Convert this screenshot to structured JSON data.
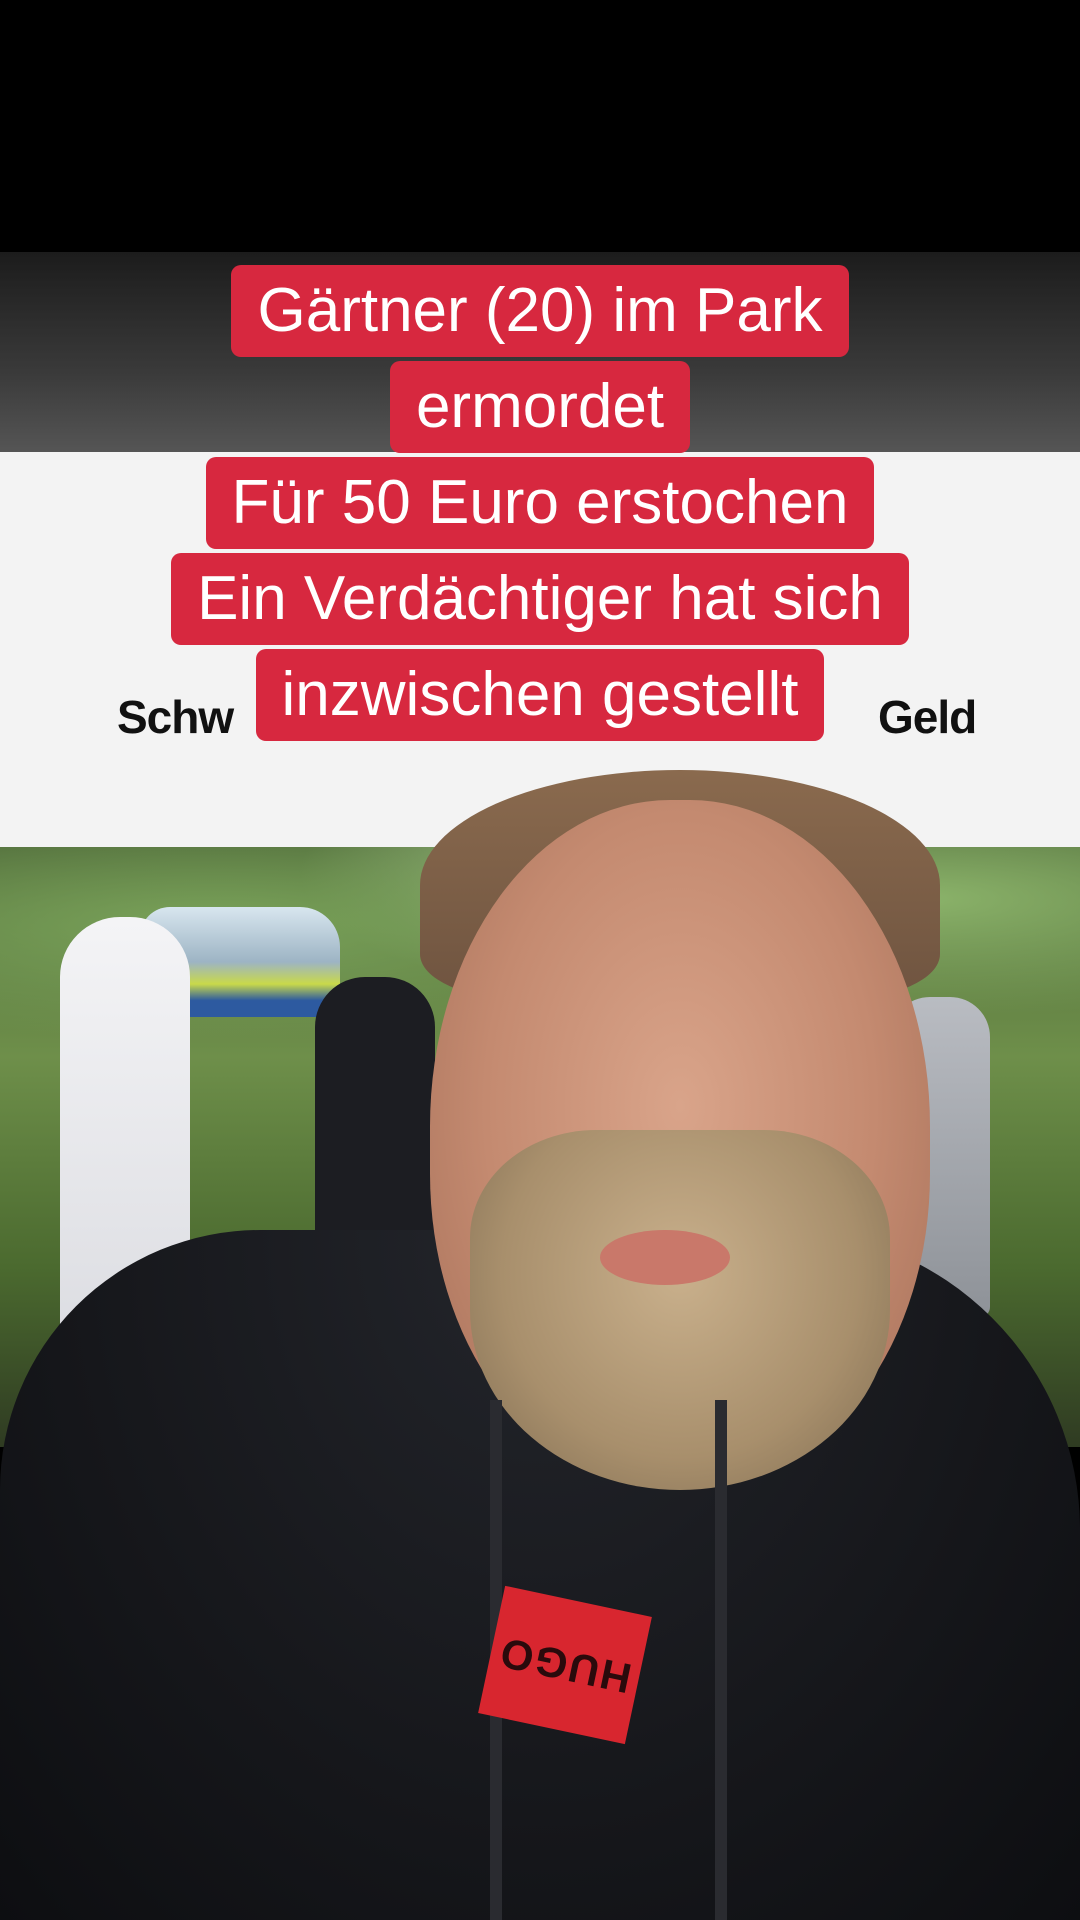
{
  "overlay_caption": {
    "lines": [
      "Gärtner (20) im Park",
      "ermordet",
      "Für 50 Euro erstochen",
      "Ein Verdächtiger hat sich",
      "inzwischen gestellt"
    ],
    "background_color": "#d7283f",
    "text_color": "#ffffff"
  },
  "article_headline_fragments": {
    "left": "Schw",
    "right": "Geld"
  },
  "hoodie_logo": {
    "text": "HUGO",
    "color": "#d8262f"
  }
}
